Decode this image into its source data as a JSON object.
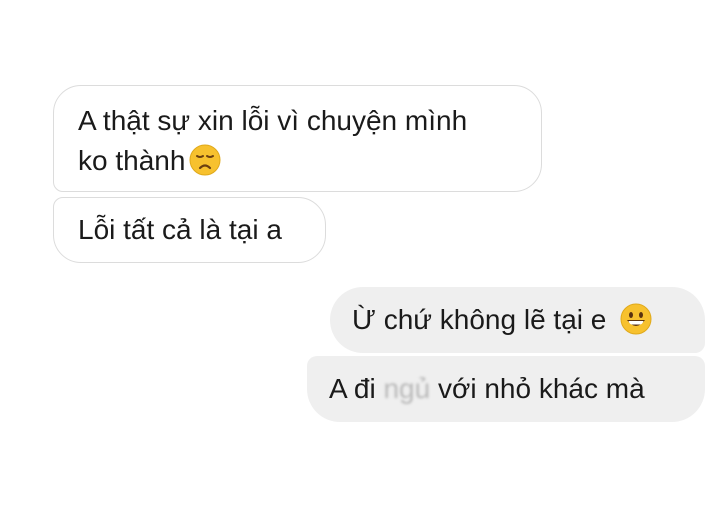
{
  "messages": [
    {
      "direction": "incoming",
      "line1": "A thật sự xin lỗi vì chuyện mình",
      "line2": "ko thành",
      "emoji": "disappointed-face"
    },
    {
      "direction": "incoming",
      "text": "Lỗi tất cả là tại a"
    },
    {
      "direction": "outgoing",
      "text": "Ừ chứ không lẽ tại e",
      "emoji": "grinning-face"
    },
    {
      "direction": "outgoing",
      "text_before": "A đi",
      "text_blurred": "ngủ",
      "text_after": "với nhỏ khác mà"
    }
  ],
  "colors": {
    "incoming_bg": "#ffffff",
    "incoming_border": "#dcdcdc",
    "outgoing_bg": "#efefef",
    "text": "#1a1a1a",
    "emoji_yellow": "#f7c12e"
  }
}
